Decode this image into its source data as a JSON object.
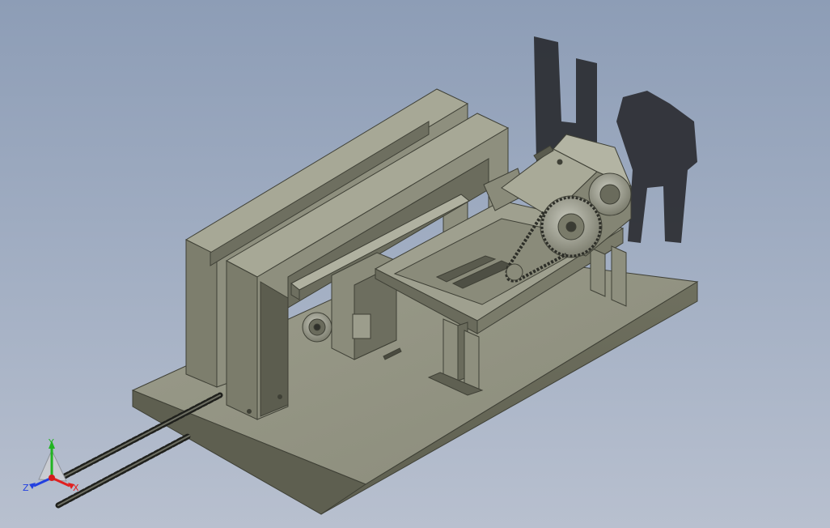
{
  "viewport": {
    "background_top": "#8d9db6",
    "background_bottom": "#b8c0cf",
    "model_color": "#8f9180",
    "shadow_color": "#2b2d32"
  },
  "triad": {
    "x_label": "X",
    "y_label": "Y",
    "z_label": "Z",
    "x_color": "#e02020",
    "y_color": "#21b421",
    "z_color": "#2240e0"
  }
}
